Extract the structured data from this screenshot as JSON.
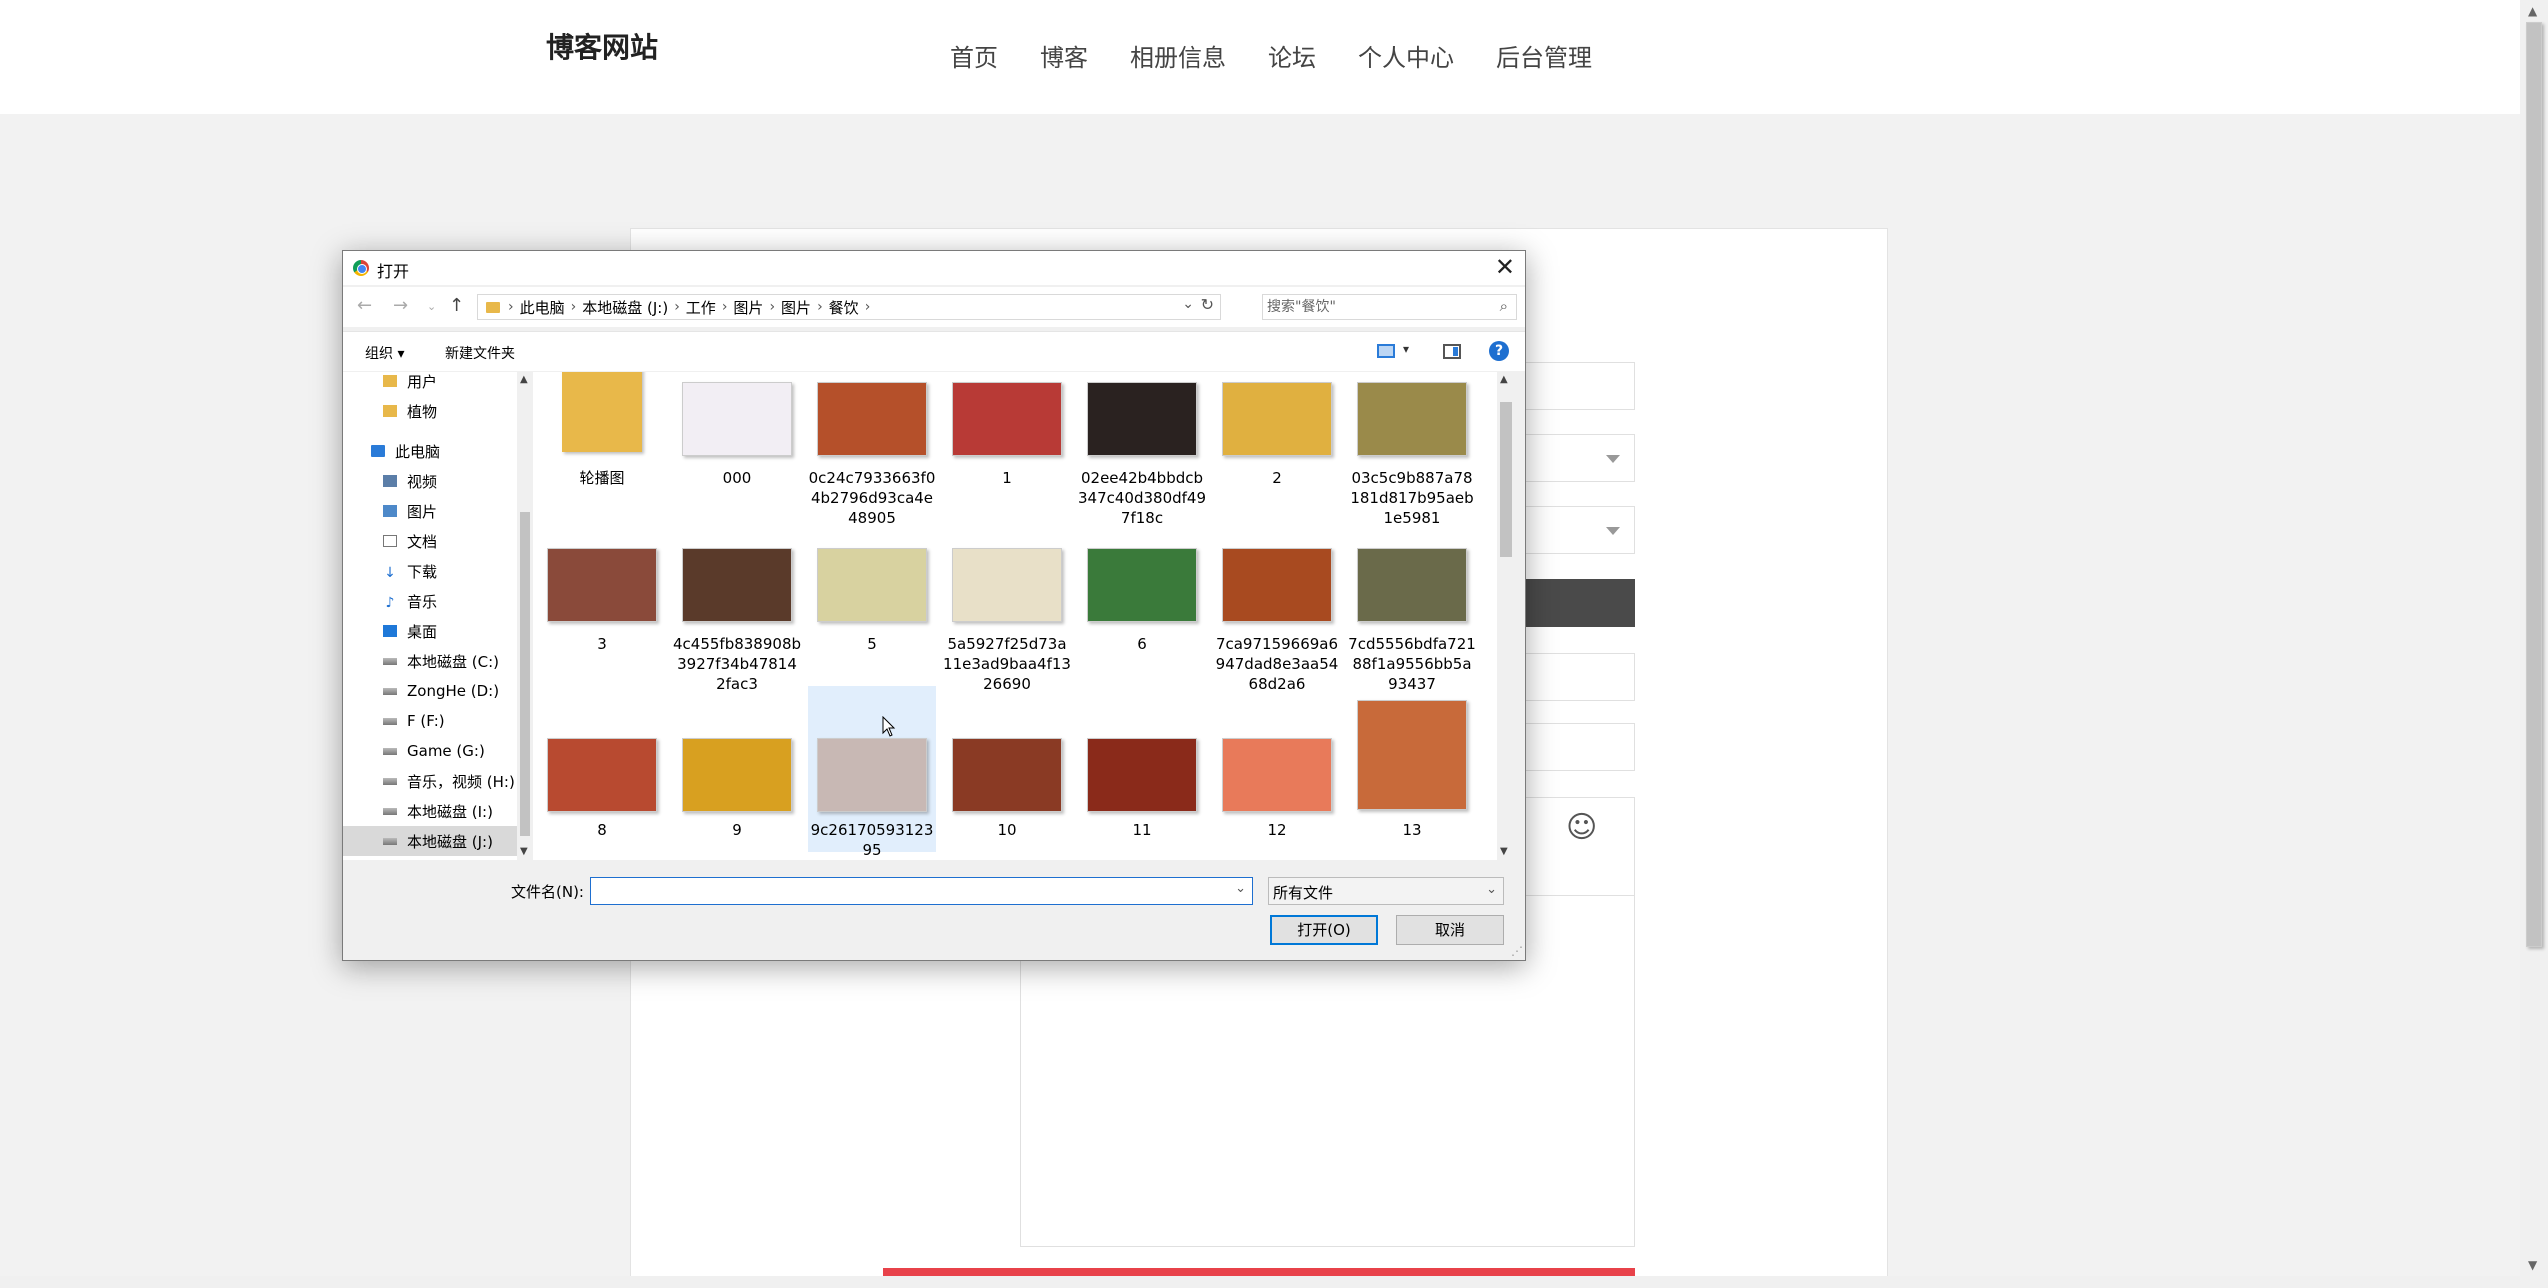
{
  "site": {
    "logo": "博客网站",
    "nav": [
      "首页",
      "博客",
      "相册信息",
      "论坛",
      "个人中心",
      "后台管理"
    ]
  },
  "dialog": {
    "title": "打开",
    "breadcrumb": [
      "此电脑",
      "本地磁盘 (J:)",
      "工作",
      "图片",
      "图片",
      "餐饮"
    ],
    "search_placeholder": "搜索\"餐饮\"",
    "toolbar": {
      "organize": "组织 ▾",
      "new_folder": "新建文件夹"
    },
    "nav_items": [
      {
        "label": "用户",
        "icon": "folder-icon"
      },
      {
        "label": "植物",
        "icon": "folder-icon"
      },
      {
        "label": "此电脑",
        "icon": "computer-icon"
      },
      {
        "label": "视频",
        "icon": "video-icon"
      },
      {
        "label": "图片",
        "icon": "pictures-icon"
      },
      {
        "label": "文档",
        "icon": "documents-icon"
      },
      {
        "label": "下载",
        "icon": "download-icon"
      },
      {
        "label": "音乐",
        "icon": "music-icon"
      },
      {
        "label": "桌面",
        "icon": "desktop-icon"
      },
      {
        "label": "本地磁盘 (C:)",
        "icon": "drive-icon"
      },
      {
        "label": "ZongHe (D:)",
        "icon": "drive-icon"
      },
      {
        "label": "F (F:)",
        "icon": "drive-icon"
      },
      {
        "label": "Game (G:)",
        "icon": "drive-icon"
      },
      {
        "label": "音乐，视频 (H:)",
        "icon": "drive-icon"
      },
      {
        "label": "本地磁盘 (I:)",
        "icon": "drive-icon"
      },
      {
        "label": "本地磁盘 (J:)",
        "icon": "drive-icon"
      }
    ],
    "files": [
      {
        "name": "轮播图",
        "color": "#e8b84a"
      },
      {
        "name": "000",
        "color": "#f2eef4"
      },
      {
        "name": "0c24c7933663f04b2796d93ca4e48905",
        "color": "#b5502a"
      },
      {
        "name": "1",
        "color": "#b83a36"
      },
      {
        "name": "02ee42b4bbdcb347c40d380df497f18c",
        "color": "#2a2220"
      },
      {
        "name": "2",
        "color": "#e0b040"
      },
      {
        "name": "03c5c9b887a78181d817b95aeb1e5981",
        "color": "#9a8a4a"
      },
      {
        "name": "3",
        "color": "#8a4a3a"
      },
      {
        "name": "4c455fb838908b3927f34b478142fac3",
        "color": "#5a3a2a"
      },
      {
        "name": "5",
        "color": "#d8d2a0"
      },
      {
        "name": "5a5927f25d73a11e3ad9baa4f1326690",
        "color": "#e8e0c8"
      },
      {
        "name": "6",
        "color": "#3a7a3a"
      },
      {
        "name": "7ca97159669a6947dad8e3aa5468d2a6",
        "color": "#a84a20"
      },
      {
        "name": "7cd5556bdfa72188f1a9556bb5a93437",
        "color": "#6a6a4a"
      },
      {
        "name": "8",
        "color": "#b84a30"
      },
      {
        "name": "9",
        "color": "#d8a020"
      },
      {
        "name": "9c2617059312395",
        "color": "#c8b8b4"
      },
      {
        "name": "10",
        "color": "#8a3a24"
      },
      {
        "name": "11",
        "color": "#8a2a1a"
      },
      {
        "name": "12",
        "color": "#e87a5a"
      },
      {
        "name": "13",
        "color": "#c86a3a"
      }
    ],
    "filename_label": "文件名(N):",
    "filename_value": "",
    "filetype": "所有文件",
    "open_button": "打开(O)",
    "cancel_button": "取消"
  }
}
